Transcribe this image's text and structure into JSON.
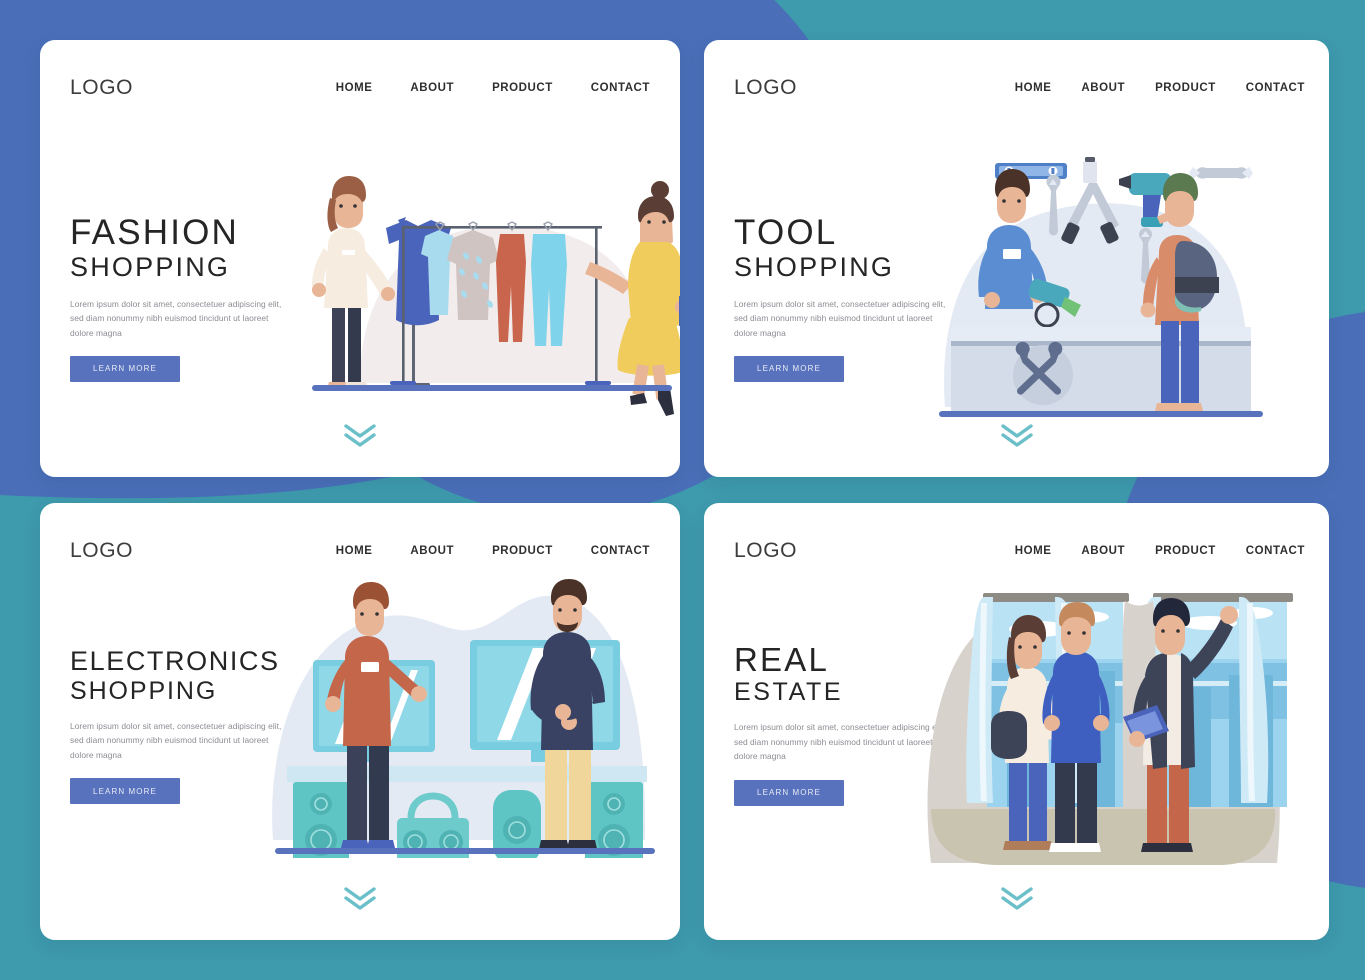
{
  "page": {
    "background_color": "#3e9aad",
    "accent_blue": "#4a6fb8",
    "button_color": "#5872bd",
    "chevron_color": "#6bbfc9",
    "card_background": "#ffffff",
    "heading_color": "#252525",
    "body_text_color": "#8c8c94"
  },
  "nav_items": [
    "HOME",
    "ABOUT",
    "PRODUCT",
    "CONTACT"
  ],
  "common": {
    "logo": "LOGO",
    "body_text": "Lorem ipsum dolor sit amet, consectetuer adipiscing elit, sed diam nonummy nibh euismod tincidunt ut laoreet dolore magna",
    "button_label": "LEARN MORE",
    "scroll_icon": "double-chevron-down-icon"
  },
  "cards": [
    {
      "id": "fashion",
      "logo": "LOGO",
      "nav": [
        "HOME",
        "ABOUT",
        "PRODUCT",
        "CONTACT"
      ],
      "title_line1": "FASHION",
      "title_line2": "SHOPPING",
      "body_text": "Lorem ipsum dolor sit amet, consectetuer adipiscing elit, sed diam nonummy nibh euismod tincidunt ut laoreet dolore magna",
      "button_label": "LEARN MORE",
      "illustration": "fashion-shopping-illustration"
    },
    {
      "id": "tool",
      "logo": "LOGO",
      "nav": [
        "HOME",
        "ABOUT",
        "PRODUCT",
        "CONTACT"
      ],
      "title_line1": "TOOL",
      "title_line2": "SHOPPING",
      "body_text": "Lorem ipsum dolor sit amet, consectetuer adipiscing elit, sed diam nonummy nibh euismod tincidunt ut laoreet dolore magna",
      "button_label": "LEARN MORE",
      "illustration": "tool-shopping-illustration"
    },
    {
      "id": "electronics",
      "logo": "LOGO",
      "nav": [
        "HOME",
        "ABOUT",
        "PRODUCT",
        "CONTACT"
      ],
      "title_line1": "ELECTRONICS",
      "title_line2": "SHOPPING",
      "body_text": "Lorem ipsum dolor sit amet, consectetuer adipiscing elit, sed diam nonummy nibh euismod tincidunt ut laoreet dolore magna",
      "button_label": "LEARN MORE",
      "illustration": "electronics-shopping-illustration"
    },
    {
      "id": "real-estate",
      "logo": "LOGO",
      "nav": [
        "HOME",
        "ABOUT",
        "PRODUCT",
        "CONTACT"
      ],
      "title_line1": "REAL",
      "title_line2": "ESTATE",
      "body_text": "Lorem ipsum dolor sit amet, consectetuer adipiscing elit, sed diam nonummy nibh euismod tincidunt ut laoreet dolore magna",
      "button_label": "LEARN MORE",
      "illustration": "real-estate-illustration"
    }
  ]
}
